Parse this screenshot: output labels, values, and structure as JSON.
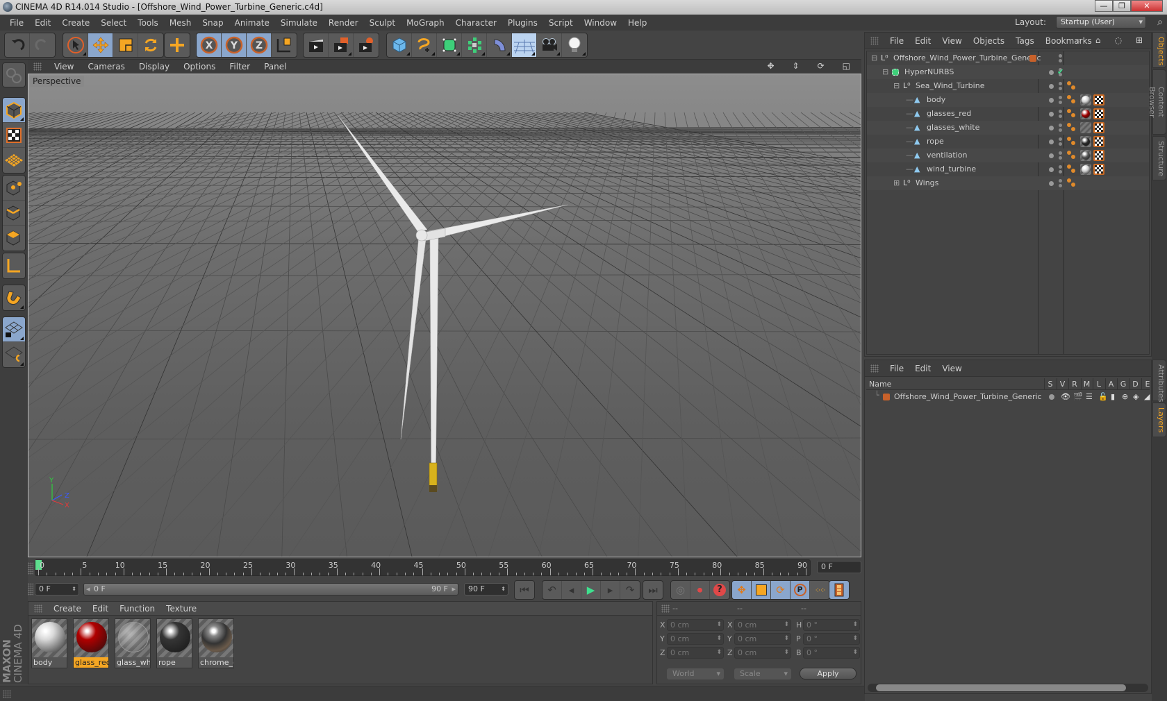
{
  "window": {
    "title": "CINEMA 4D R14.014 Studio - [Offshore_Wind_Power_Turbine_Generic.c4d]",
    "controls": [
      "minimize",
      "restore",
      "close"
    ]
  },
  "menubar": {
    "items": [
      "File",
      "Edit",
      "Create",
      "Select",
      "Tools",
      "Mesh",
      "Snap",
      "Animate",
      "Simulate",
      "Render",
      "Sculpt",
      "MoGraph",
      "Character",
      "Plugins",
      "Script",
      "Window",
      "Help"
    ],
    "layout_label": "Layout:",
    "layout_value": "Startup (User)"
  },
  "toolbar": {
    "groups": [
      [
        "undo-icon",
        "redo-icon"
      ],
      [
        "live-selection-icon",
        "move-icon",
        "scale-icon",
        "rotate-icon"
      ],
      [
        "add-object-icon"
      ],
      [
        "x-axis-lock-icon",
        "y-axis-lock-icon",
        "z-axis-lock-icon",
        "coordinate-system-icon"
      ],
      [
        "render-view-icon",
        "render-picture-viewer-icon",
        "render-settings-icon"
      ],
      [
        "cube-primitive-icon",
        "spline-pen-icon",
        "subdivision-surface-icon",
        "array-mograph-icon",
        "bend-deformer-icon",
        "floor-scene-icon",
        "camera-icon",
        "light-icon"
      ]
    ]
  },
  "left_toolbar": {
    "items": [
      "make-editable-icon",
      "model-mode-icon",
      "texture-mode-icon",
      "workplane-mode-icon",
      "points-mode-icon",
      "edges-mode-icon",
      "polygons-mode-icon",
      "axis-mode-icon",
      "snap-magnet-icon",
      "locked-workplane-icon",
      "workplane-rotate-icon"
    ]
  },
  "viewport": {
    "menu": [
      "View",
      "Cameras",
      "Display",
      "Options",
      "Filter",
      "Panel"
    ],
    "label": "Perspective",
    "axis_labels": {
      "y": "Y",
      "z": "Z",
      "x": "X"
    }
  },
  "timeline": {
    "ticks": [
      0,
      5,
      10,
      15,
      20,
      25,
      30,
      35,
      40,
      45,
      50,
      55,
      60,
      65,
      70,
      75,
      80,
      85,
      90
    ],
    "current_frame_marker": 0,
    "current_frame": "0 F",
    "start_field": "0 F",
    "range_start": "0 F",
    "range_end": "90 F",
    "end_field": "90 F"
  },
  "playback": {
    "buttons": [
      "go-to-start-icon",
      "previous-key-icon",
      "step-back-icon",
      "play-icon",
      "step-forward-icon",
      "next-key-icon",
      "go-to-end-icon"
    ],
    "record_buttons": [
      "autokey-icon",
      "record-key-icon",
      "keyframe-selection-icon"
    ],
    "key_buttons": [
      "key-position-icon",
      "key-scale-icon",
      "key-rotation-icon",
      "key-parameter-icon",
      "key-point-level-icon"
    ],
    "timeline_button": "timeline-window-icon"
  },
  "materials": {
    "menu": [
      "Create",
      "Edit",
      "Function",
      "Texture"
    ],
    "items": [
      {
        "name": "body",
        "color": "#d8d8d8",
        "selected": false
      },
      {
        "name": "glass_red",
        "color": "#b00000",
        "selected": true
      },
      {
        "name": "glass_whit",
        "color": "#8a8a8a",
        "selected": false
      },
      {
        "name": "rope",
        "color": "#353535",
        "selected": false
      },
      {
        "name": "chrome_de",
        "color": "#6b6b6b",
        "selected": false
      }
    ]
  },
  "coordinates": {
    "headers": [
      "--",
      "--",
      "--"
    ],
    "rows": [
      {
        "l1": "X",
        "v1": "0 cm",
        "l2": "X",
        "v2": "0 cm",
        "l3": "H",
        "v3": "0 °"
      },
      {
        "l1": "Y",
        "v1": "0 cm",
        "l2": "Y",
        "v2": "0 cm",
        "l3": "P",
        "v3": "0 °"
      },
      {
        "l1": "Z",
        "v1": "0 cm",
        "l2": "Z",
        "v2": "0 cm",
        "l3": "B",
        "v3": "0 °"
      }
    ],
    "space": "World",
    "mode": "Scale",
    "apply": "Apply"
  },
  "objects_panel": {
    "menu": [
      "File",
      "Edit",
      "View",
      "Objects",
      "Tags",
      "Bookmarks"
    ],
    "tree": [
      {
        "name": "Offshore_Wind_Power_Turbine_Generic",
        "type": "null",
        "depth": 0,
        "expand": "-",
        "layer_color": "#c8612a",
        "tags": []
      },
      {
        "name": "HyperNURBS",
        "type": "hypernurbs",
        "depth": 1,
        "expand": "-",
        "check": "✔",
        "tags": []
      },
      {
        "name": "Sea_Wind_Turbine",
        "type": "null",
        "depth": 2,
        "expand": "-",
        "tags": [
          "phong"
        ]
      },
      {
        "name": "body",
        "type": "polygon",
        "depth": 3,
        "tags": [
          "phong",
          "mat:#d0d0d0",
          "uvw"
        ]
      },
      {
        "name": "glasses_red",
        "type": "polygon",
        "depth": 3,
        "tags": [
          "phong",
          "mat:#a00000",
          "uvw"
        ]
      },
      {
        "name": "glasses_white",
        "type": "polygon",
        "depth": 3,
        "tags": [
          "phong",
          "mat:none",
          "uvw"
        ]
      },
      {
        "name": "rope",
        "type": "polygon",
        "depth": 3,
        "tags": [
          "phong",
          "mat:#2a2a2a",
          "uvw"
        ]
      },
      {
        "name": "ventilation",
        "type": "polygon",
        "depth": 3,
        "tags": [
          "phong",
          "mat:#555555",
          "uvw"
        ]
      },
      {
        "name": "wind_turbine",
        "type": "polygon",
        "depth": 3,
        "tags": [
          "phong",
          "mat:#d0d0d0",
          "uvw"
        ]
      },
      {
        "name": "Wings",
        "type": "null",
        "depth": 2,
        "expand": "+",
        "tags": [
          "phong"
        ]
      }
    ]
  },
  "layers_panel": {
    "menu": [
      "File",
      "Edit",
      "View"
    ],
    "columns": [
      "Name",
      "S",
      "V",
      "R",
      "M",
      "L",
      "A",
      "G",
      "D",
      "E"
    ],
    "rows": [
      {
        "name": "Offshore_Wind_Power_Turbine_Generic",
        "color": "#c8612a"
      }
    ]
  },
  "right_tabs": [
    {
      "label": "Objects",
      "active": true
    },
    {
      "label": "Content Browser",
      "active": false
    },
    {
      "label": "Structure",
      "active": false
    },
    {
      "label": "Attributes",
      "active": false
    },
    {
      "label": "Layers",
      "active": true
    }
  ],
  "branding": {
    "line1": "MAXON",
    "line2": "CINEMA 4D"
  },
  "colors": {
    "accent": "#f5a623",
    "active_blue": "#8aa6cc",
    "play_green": "#3ee08e"
  }
}
